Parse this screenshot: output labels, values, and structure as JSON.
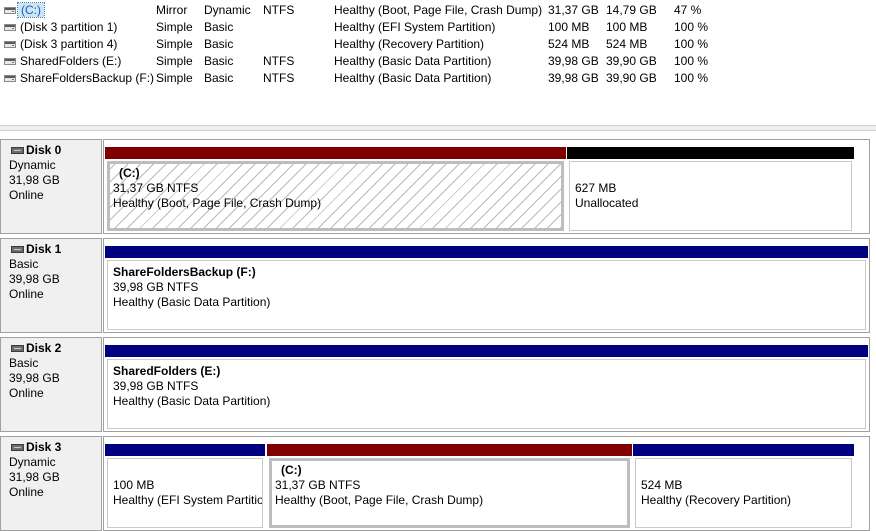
{
  "volumes": [
    {
      "name": "(C:)",
      "layout": "Mirror",
      "type": "Dynamic",
      "fs": "NTFS",
      "status": "Healthy (Boot, Page File, Crash Dump)",
      "capacity": "31,37 GB",
      "free": "14,79 GB",
      "pct": "47 %"
    },
    {
      "name": "(Disk 3 partition 1)",
      "layout": "Simple",
      "type": "Basic",
      "fs": "",
      "status": "Healthy (EFI System Partition)",
      "capacity": "100 MB",
      "free": "100 MB",
      "pct": "100 %"
    },
    {
      "name": "(Disk 3 partition 4)",
      "layout": "Simple",
      "type": "Basic",
      "fs": "",
      "status": "Healthy (Recovery Partition)",
      "capacity": "524 MB",
      "free": "524 MB",
      "pct": "100 %"
    },
    {
      "name": "SharedFolders (E:)",
      "layout": "Simple",
      "type": "Basic",
      "fs": "NTFS",
      "status": "Healthy (Basic Data Partition)",
      "capacity": "39,98 GB",
      "free": "39,90 GB",
      "pct": "100 %"
    },
    {
      "name": "ShareFoldersBackup (F:)",
      "layout": "Simple",
      "type": "Basic",
      "fs": "NTFS",
      "status": "Healthy (Basic Data Partition)",
      "capacity": "39,98 GB",
      "free": "39,90 GB",
      "pct": "100 %"
    }
  ],
  "disks": [
    {
      "title": "Disk 0",
      "type": "Dynamic",
      "size": "31,98 GB",
      "state": "Online",
      "parts": [
        {
          "name": "(C:)",
          "size": "31,37 GB NTFS",
          "status": "Healthy (Boot, Page File, Crash Dump)"
        },
        {
          "name": "",
          "size": "627 MB",
          "status": "Unallocated"
        }
      ]
    },
    {
      "title": "Disk 1",
      "type": "Basic",
      "size": "39,98 GB",
      "state": "Online",
      "parts": [
        {
          "name": "ShareFoldersBackup  (F:)",
          "size": "39,98 GB NTFS",
          "status": "Healthy (Basic Data Partition)"
        }
      ]
    },
    {
      "title": "Disk 2",
      "type": "Basic",
      "size": "39,98 GB",
      "state": "Online",
      "parts": [
        {
          "name": "SharedFolders  (E:)",
          "size": "39,98 GB NTFS",
          "status": "Healthy (Basic Data Partition)"
        }
      ]
    },
    {
      "title": "Disk 3",
      "type": "Dynamic",
      "size": "31,98 GB",
      "state": "Online",
      "parts": [
        {
          "name": "",
          "size": "100 MB",
          "status": "Healthy (EFI System Partitio"
        },
        {
          "name": "(C:)",
          "size": "31,37 GB NTFS",
          "status": "Healthy (Boot, Page File, Crash Dump)"
        },
        {
          "name": "",
          "size": "524 MB",
          "status": "Healthy (Recovery Partition)"
        }
      ]
    }
  ],
  "colors": {
    "mirror": "#800000",
    "unallocated": "#000000",
    "primary": "#000080"
  },
  "icons": {
    "volume": "volume-icon",
    "disk": "disk-icon"
  }
}
